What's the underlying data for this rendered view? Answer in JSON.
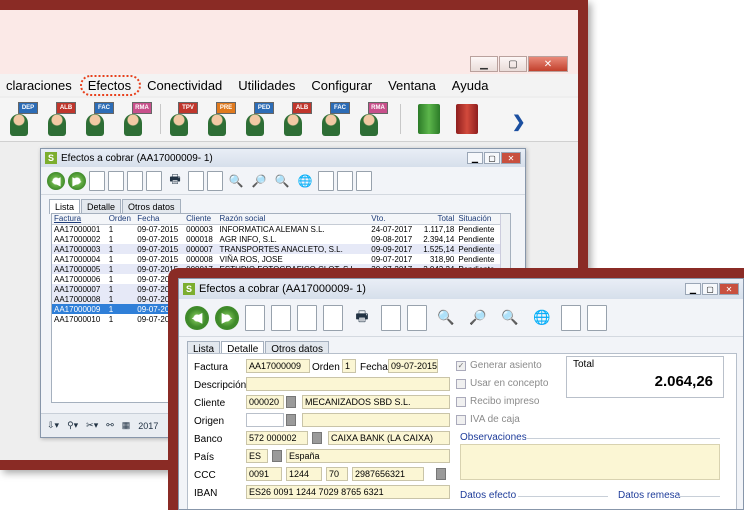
{
  "menu": [
    "claraciones",
    "Efectos",
    "Conectividad",
    "Utilidades",
    "Configurar",
    "Ventana",
    "Ayuda"
  ],
  "toolbar_big": [
    {
      "badge": "DEP",
      "color": "blue"
    },
    {
      "badge": "ALB",
      "color": "red"
    },
    {
      "badge": "FAC",
      "color": "blue"
    },
    {
      "badge": "RMA",
      "color": "pink"
    },
    {
      "badge": "TPV",
      "color": "red"
    },
    {
      "badge": "PRE",
      "color": "orange"
    },
    {
      "badge": "PED",
      "color": "blue"
    },
    {
      "badge": "ALB",
      "color": "red"
    },
    {
      "badge": "FAC",
      "color": "blue"
    },
    {
      "badge": "RMA",
      "color": "pink"
    }
  ],
  "win1": {
    "title": "Efectos a cobrar (AA17000009- 1)",
    "tabs": [
      "Lista",
      "Detalle",
      "Otros datos"
    ],
    "columns": [
      "Factura",
      "Orden",
      "Fecha",
      "Cliente",
      "Razón social",
      "Vto.",
      "Total",
      "Situación"
    ],
    "rows": [
      [
        "AA17000001",
        "1",
        "09-07-2015",
        "000003",
        "INFORMATICA ALEMAN S.L.",
        "24-07-2017",
        "1.117,18",
        "Pendiente"
      ],
      [
        "AA17000002",
        "1",
        "09-07-2015",
        "000018",
        "AGR INFO, S.L.",
        "09-08-2017",
        "2.394,14",
        "Pendiente"
      ],
      [
        "AA17000003",
        "1",
        "09-07-2015",
        "000007",
        "TRANSPORTES ANACLETO, S.L.",
        "09-09-2017",
        "1.525,14",
        "Pendiente"
      ],
      [
        "AA17000004",
        "1",
        "09-07-2015",
        "000008",
        "VIÑA ROS, JOSE",
        "09-07-2017",
        "318,90",
        "Pendiente"
      ],
      [
        "AA17000005",
        "1",
        "09-07-2015",
        "000017",
        "ESTUDIO FOTOGRAFICO CLOT, S.L",
        "30-07-2017",
        "2.043,24",
        "Pendiente"
      ],
      [
        "AA17000006",
        "1",
        "09-07-2015",
        "000009",
        "MUEBLES DE OFICINA CLOT, S.L.",
        "08-08-2017",
        "1.991,72",
        "Pendiente"
      ],
      [
        "AA17000007",
        "1",
        "09-07-2015",
        "",
        "",
        "",
        "",
        ""
      ],
      [
        "AA17000008",
        "1",
        "09-07-2015",
        "",
        "",
        "",
        "",
        ""
      ],
      [
        "AA17000009",
        "1",
        "09-07-2015",
        "",
        "",
        "",
        "",
        ""
      ],
      [
        "AA17000010",
        "1",
        "09-07-2015",
        "",
        "",
        "",
        "",
        ""
      ]
    ],
    "footer_year": "2017"
  },
  "win2": {
    "title": "Efectos a cobrar (AA17000009- 1)",
    "tabs": [
      "Lista",
      "Detalle",
      "Otros datos"
    ],
    "labels": {
      "factura": "Factura",
      "orden": "Orden",
      "fecha": "Fecha",
      "descripcion": "Descripción",
      "cliente": "Cliente",
      "origen": "Origen",
      "banco": "Banco",
      "pais": "País",
      "ccc": "CCC",
      "iban": "IBAN"
    },
    "values": {
      "factura": "AA17000009",
      "orden": "1",
      "fecha": "09-07-2015",
      "cliente_code": "000020",
      "cliente_name": "MECANIZADOS SBD S.L.",
      "banco_code": "572 000002",
      "banco_name": "CAIXA BANK (LA CAIXA)",
      "pais_code": "ES",
      "pais_name": "España",
      "ccc1": "0091",
      "ccc2": "1244",
      "ccc3": "70",
      "ccc4": "2987656321",
      "iban": "ES26 0091 1244 7029 8765 6321"
    },
    "checks": [
      "Generar asiento",
      "Usar en concepto",
      "Recibo impreso",
      "IVA de caja"
    ],
    "total_label": "Total",
    "total_value": "2.064,26",
    "observaciones": "Observaciones",
    "datos_efecto": "Datos efecto",
    "datos_remesa": "Datos remesa"
  }
}
